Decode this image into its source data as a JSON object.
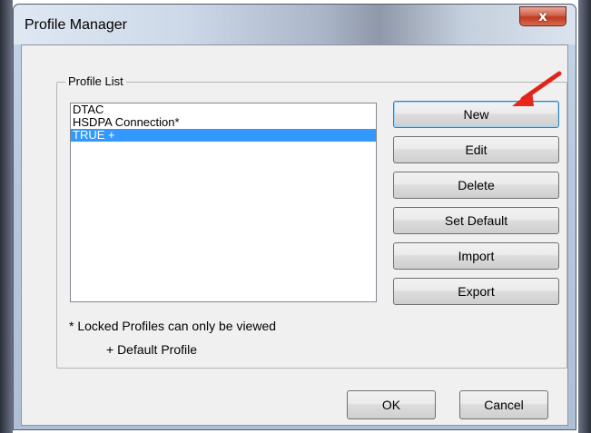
{
  "window": {
    "title": "Profile Manager",
    "close_glyph": "x"
  },
  "group": {
    "label": "Profile List"
  },
  "profiles": [
    "DTAC",
    "HSDPA Connection*",
    "TRUE +"
  ],
  "selected_index": 2,
  "buttons": {
    "new": "New",
    "edit": "Edit",
    "delete": "Delete",
    "set_default": "Set Default",
    "import": "Import",
    "export": "Export"
  },
  "notes": {
    "locked": "* Locked Profiles can only be viewed",
    "default": "+ Default Profile"
  },
  "dialog_buttons": {
    "ok": "OK",
    "cancel": "Cancel"
  },
  "colors": {
    "selection": "#3399ff",
    "arrow": "#e8261b",
    "close": "#c0391f"
  },
  "annotation": {
    "icon": "red-arrow-icon"
  }
}
